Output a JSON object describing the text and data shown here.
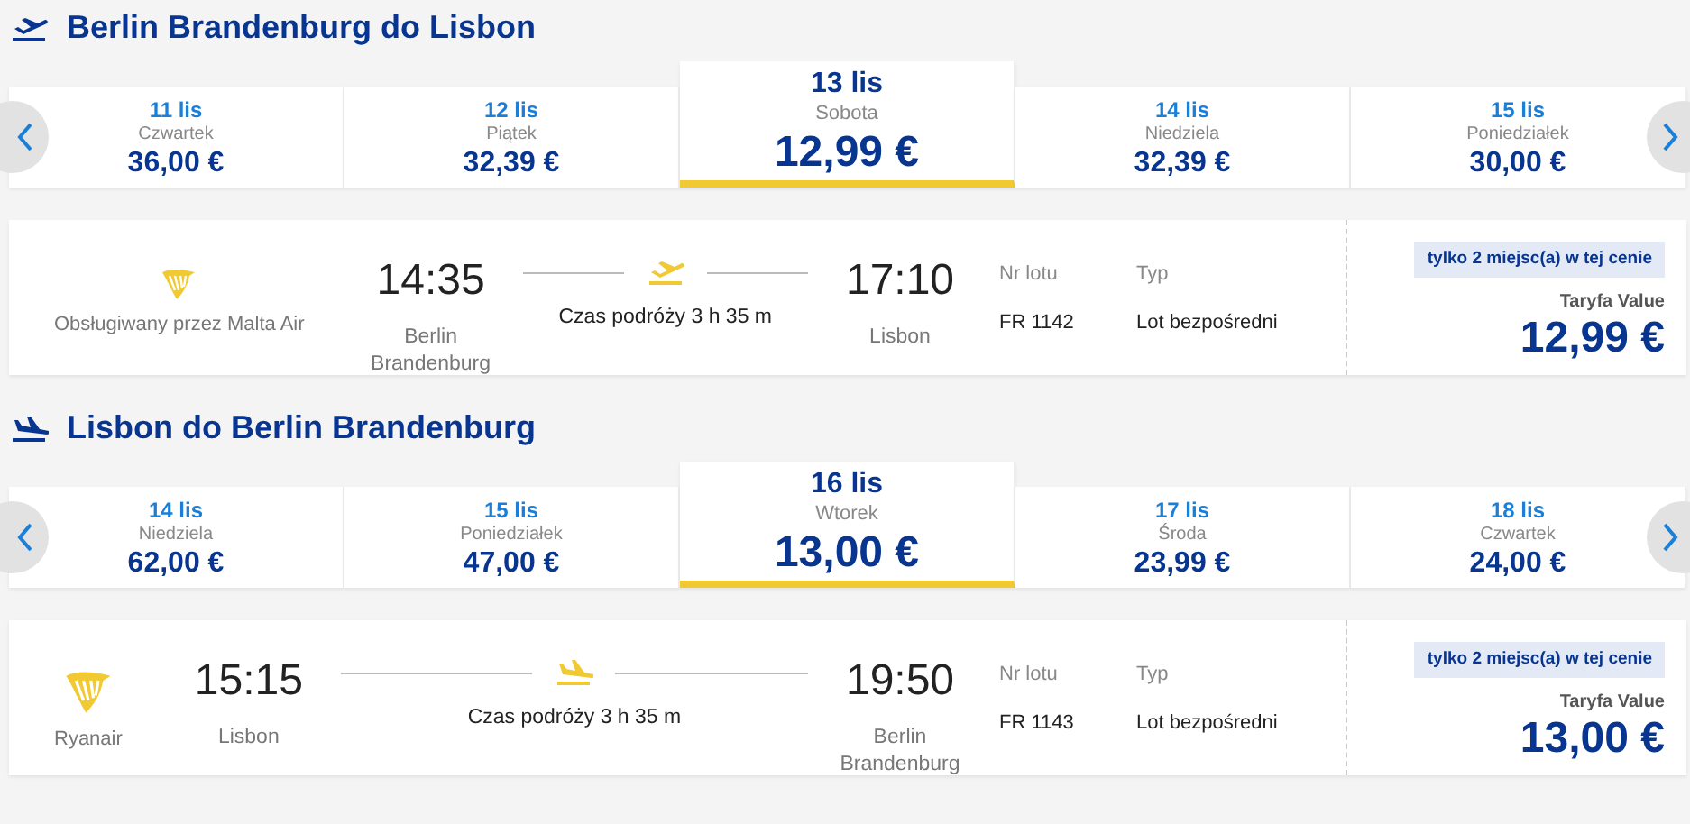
{
  "sections": [
    {
      "kind": "departure",
      "title": "Berlin Brandenburg do Lisbon",
      "dates": [
        {
          "date": "11 lis",
          "weekday": "Czwartek",
          "price": "36,00 €",
          "selected": false
        },
        {
          "date": "12 lis",
          "weekday": "Piątek",
          "price": "32,39 €",
          "selected": false
        },
        {
          "date": "13 lis",
          "weekday": "Sobota",
          "price": "12,99 €",
          "selected": true
        },
        {
          "date": "14 lis",
          "weekday": "Niedziela",
          "price": "32,39 €",
          "selected": false
        },
        {
          "date": "15 lis",
          "weekday": "Poniedziałek",
          "price": "30,00 €",
          "selected": false
        }
      ],
      "flight": {
        "airline": "Obsługiwany przez Malta Air",
        "dep_time": "14:35",
        "dep_city": "Berlin Brandenburg",
        "duration": "Czas podróży 3 h 35 m",
        "arr_time": "17:10",
        "arr_city": "Lisbon",
        "flight_no_label": "Nr lotu",
        "flight_no": "FR 1142",
        "type_label": "Typ",
        "type": "Lot bezpośredni",
        "badge": "tylko 2 miejsc(a) w tej cenie",
        "fare": "Taryfa Value",
        "price": "12,99 €"
      }
    },
    {
      "kind": "arrival",
      "title": "Lisbon do Berlin Brandenburg",
      "dates": [
        {
          "date": "14 lis",
          "weekday": "Niedziela",
          "price": "62,00 €",
          "selected": false
        },
        {
          "date": "15 lis",
          "weekday": "Poniedziałek",
          "price": "47,00 €",
          "selected": false
        },
        {
          "date": "16 lis",
          "weekday": "Wtorek",
          "price": "13,00 €",
          "selected": true
        },
        {
          "date": "17 lis",
          "weekday": "Środa",
          "price": "23,99 €",
          "selected": false
        },
        {
          "date": "18 lis",
          "weekday": "Czwartek",
          "price": "24,00 €",
          "selected": false
        }
      ],
      "flight": {
        "airline": "Ryanair",
        "dep_time": "15:15",
        "dep_city": "Lisbon",
        "duration": "Czas podróży 3 h 35 m",
        "arr_time": "19:50",
        "arr_city": "Berlin Brandenburg",
        "flight_no_label": "Nr lotu",
        "flight_no": "FR 1143",
        "type_label": "Typ",
        "type": "Lot bezpośredni",
        "badge": "tylko 2 miejsc(a) w tej cenie",
        "fare": "Taryfa Value",
        "price": "13,00 €"
      }
    }
  ]
}
